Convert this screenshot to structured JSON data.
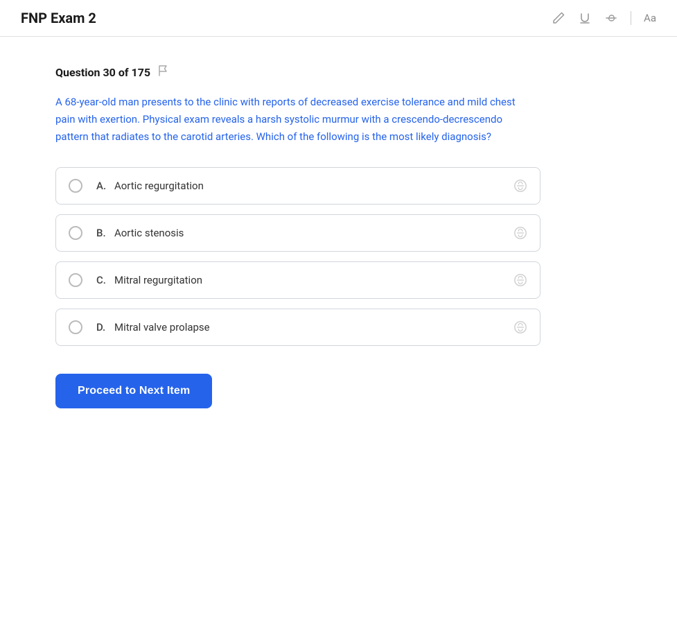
{
  "header": {
    "title": "FNP  Exam 2",
    "tools": {
      "pencil_label": "pencil",
      "underline_label": "U",
      "strikethrough_label": "S",
      "font_label": "Aa"
    }
  },
  "question": {
    "number_label": "Question 30 of 175",
    "flag_label": "flag",
    "text": "A 68-year-old man presents to the clinic with reports of decreased exercise tolerance and mild chest pain with exertion. Physical exam reveals a harsh systolic murmur with a crescendo-decrescendo pattern that radiates to the carotid arteries. Which of the following is the most likely diagnosis?",
    "options": [
      {
        "letter": "A.",
        "text": "Aortic regurgitation"
      },
      {
        "letter": "B.",
        "text": "Aortic stenosis"
      },
      {
        "letter": "C.",
        "text": "Mitral regurgitation"
      },
      {
        "letter": "D.",
        "text": "Mitral valve prolapse"
      }
    ]
  },
  "buttons": {
    "proceed_label": "Proceed to Next Item"
  }
}
